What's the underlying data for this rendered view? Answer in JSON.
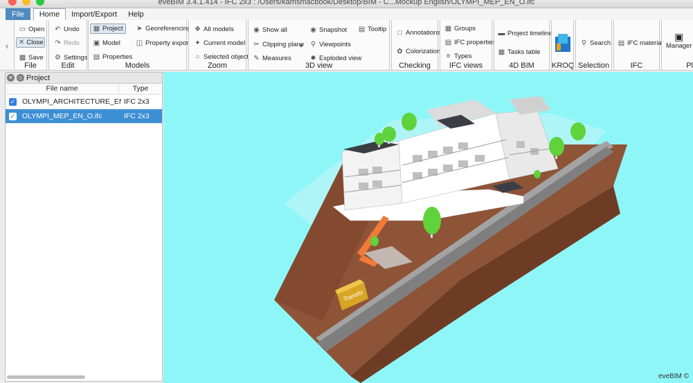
{
  "window": {
    "title": "eveBIM 3.4.1.414 - IFC 2x3 : /Users/kamsmacbook/Desktop/BIM - C...Mockup English/OLYMPI_MEP_EN_O.ifc"
  },
  "colors": {
    "file_menu": "#4f8bbf",
    "viewport_bg": "#8ff6f8",
    "selected_row": "#3d8fd4",
    "terrain": "#8e5437",
    "road": "#9e9e9e"
  },
  "menubar": {
    "items": [
      "File",
      "Home",
      "Import/Export",
      "Help"
    ]
  },
  "ribbon": {
    "file": {
      "label": "File",
      "buttons": [
        "Open",
        "Close",
        "Save"
      ]
    },
    "edit": {
      "label": "Edit",
      "buttons": [
        "Undo",
        "Redo",
        "Settings"
      ]
    },
    "models": {
      "label": "Models",
      "buttons": [
        "Project",
        "Model",
        "Properties",
        "Georeferencing",
        "Property export"
      ]
    },
    "zoom": {
      "label": "Zoom",
      "buttons": [
        "All models",
        "Current model",
        "Selected objects"
      ]
    },
    "view3d": {
      "label": "3D view",
      "buttons": [
        "Show all",
        "Clipping plane",
        "Measures",
        "Snapshot",
        "Viewpoints",
        "Exploded view",
        "Tooltip"
      ]
    },
    "checking": {
      "label": "Checking",
      "buttons": [
        "Annotations",
        "Colorization"
      ]
    },
    "ifc_views": {
      "label": "IFC views",
      "buttons": [
        "Groups",
        "IFC properties",
        "Types"
      ]
    },
    "bim4d": {
      "label": "4D BIM",
      "buttons": [
        "Project timeline",
        "Tasks table"
      ]
    },
    "kroqi": {
      "label": "KROQI"
    },
    "selection": {
      "label": "Selection",
      "buttons": [
        "Search"
      ]
    },
    "ifc": {
      "label": "IFC",
      "buttons": [
        "IFC material"
      ]
    },
    "pl": {
      "label": "Pl",
      "buttons": [
        "Manager"
      ]
    }
  },
  "project_panel": {
    "title": "Project",
    "columns": [
      "File name",
      "Type"
    ],
    "rows": [
      {
        "name": "OLYMPI_ARCHITECTURE_EN.ifc",
        "type": "IFC 2x3",
        "checked": true,
        "selected": false
      },
      {
        "name": "OLYMPI_MEP_EN_O.ifc",
        "type": "IFC 2x3",
        "checked": true,
        "selected": true
      }
    ]
  },
  "viewport": {
    "sign_text": "Transfo",
    "brand": "eveBIM ©"
  }
}
